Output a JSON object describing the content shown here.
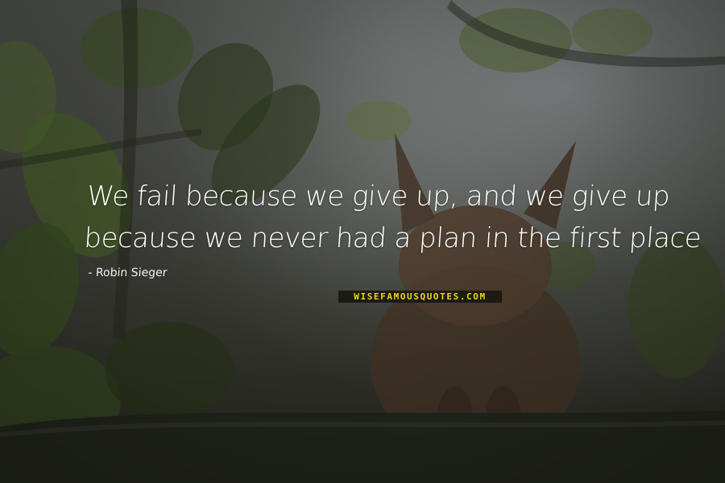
{
  "quote": {
    "lines": [
      "We fail because we give up, and we give up",
      "because we never had a plan in the first place"
    ],
    "author": "- Robin Sieger"
  },
  "watermark": {
    "text": "WISEFAMOUSQUOTES.COM"
  },
  "colors": {
    "quote_text": "#ffffff",
    "watermark_text": "#f0d41a",
    "watermark_bg": "#1b1b12"
  }
}
